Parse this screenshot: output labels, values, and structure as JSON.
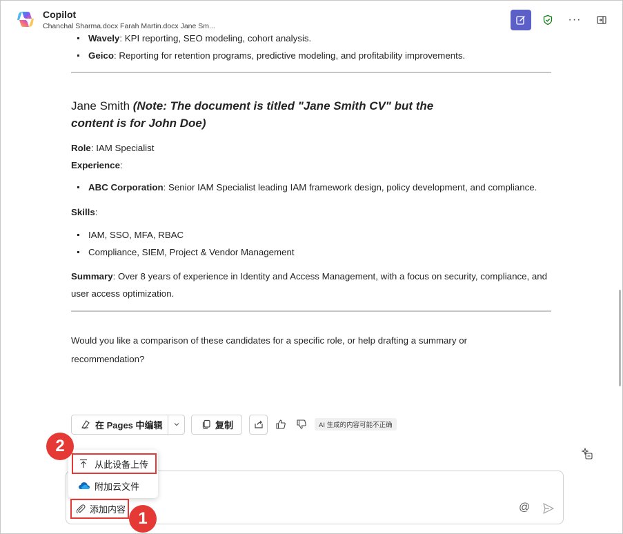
{
  "header": {
    "title": "Copilot",
    "subtitle": "Chanchal Sharma.docx Farah Martin.docx Jane Sm...",
    "icons": [
      "copilot-logo",
      "new-chat-icon",
      "shield-check-icon",
      "more-icon",
      "open-panel-icon"
    ],
    "more_glyph": "···",
    "accent": "#5b5fc7"
  },
  "content": {
    "prev_bullets": [
      {
        "bold": "Wavely",
        "text": ": KPI reporting, SEO modeling, cohort analysis."
      },
      {
        "bold": "Geico",
        "text": ": Reporting for retention programs, predictive modeling, and profitability improvements."
      }
    ],
    "person": {
      "name": "Jane Smith ",
      "note": "(Note: The document is titled \"Jane Smith CV\" but the content is for John Doe)",
      "role_label": "Role",
      "role_value": ": IAM Specialist",
      "experience_label": "Experience",
      "experience_colon": ":",
      "experience": [
        {
          "bold": "ABC Corporation",
          "text": ": Senior IAM Specialist leading IAM framework design, policy development, and compliance."
        }
      ],
      "skills_label": "Skills",
      "skills_colon": ":",
      "skills": [
        "IAM, SSO, MFA, RBAC",
        "Compliance, SIEM, Project & Vendor Management"
      ],
      "summary_label": "Summary",
      "summary_value": ": Over 8 years of experience in Identity and Access Management, with a focus on security, compliance, and user access optimization."
    },
    "question": "Would you like a comparison of these candidates for a specific role, or help drafting a summary or recommendation?"
  },
  "actions": {
    "edit_in_pages": "在 Pages 中编辑",
    "copy": "复制",
    "ai_note": "AI 生成的内容可能不正确"
  },
  "menu": {
    "upload": "从此设备上传",
    "attach_cloud": "附加云文件"
  },
  "composer": {
    "attach_label": "添加内容",
    "at_glyph": "@"
  },
  "badges": {
    "one": "1",
    "two": "2",
    "color": "#e53935"
  }
}
